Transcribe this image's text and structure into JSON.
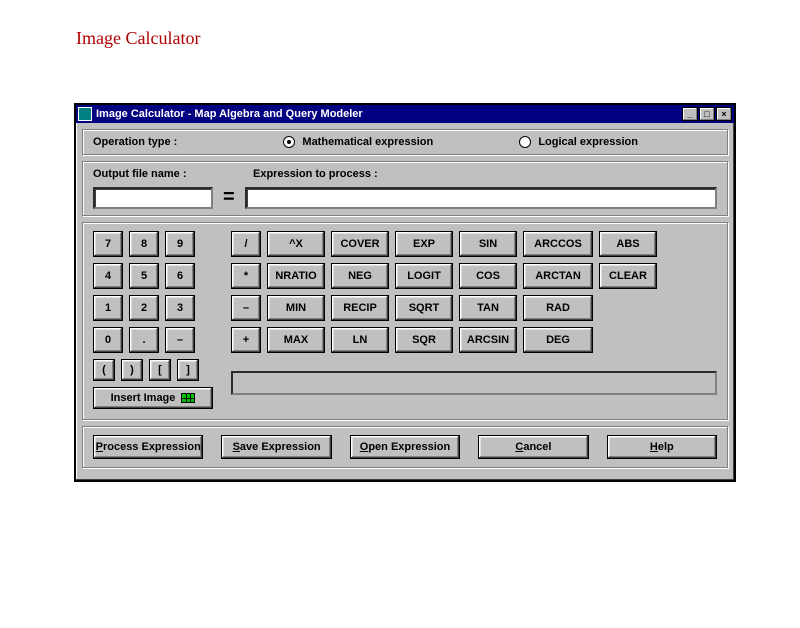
{
  "page_heading": "Image Calculator",
  "window": {
    "title": "Image Calculator - Map  Algebra and Query Modeler"
  },
  "operation_type": {
    "label": "Operation type :",
    "options": {
      "math": "Mathematical expression",
      "logical": "Logical expression"
    },
    "selected": "math"
  },
  "fields": {
    "output_label": "Output file name :",
    "expr_label": "Expression to process :",
    "output_value": "",
    "expr_value": "",
    "equals": "="
  },
  "keypad": {
    "numbers": [
      [
        "7",
        "8",
        "9"
      ],
      [
        "4",
        "5",
        "6"
      ],
      [
        "1",
        "2",
        "3"
      ],
      [
        "0",
        ".",
        "–"
      ]
    ],
    "parens": [
      "(",
      ")",
      "[",
      "]"
    ],
    "insert_image": "Insert Image",
    "ops": [
      "/",
      "*",
      "–",
      "+"
    ],
    "col1": [
      "^X",
      "NRATIO",
      "MIN",
      "MAX"
    ],
    "col2": [
      "COVER",
      "NEG",
      "RECIP",
      "LN"
    ],
    "col3": [
      "EXP",
      "LOGIT",
      "SQRT",
      "SQR"
    ],
    "col4": [
      "SIN",
      "COS",
      "TAN",
      "ARCSIN"
    ],
    "col5": [
      "ARCCOS",
      "ARCTAN",
      "RAD",
      "DEG"
    ],
    "col6": [
      "ABS",
      "CLEAR"
    ]
  },
  "actions": {
    "process": "Process Expression",
    "save": "Save Expression",
    "open": "Open Expression",
    "cancel": "Cancel",
    "help": "Help"
  }
}
